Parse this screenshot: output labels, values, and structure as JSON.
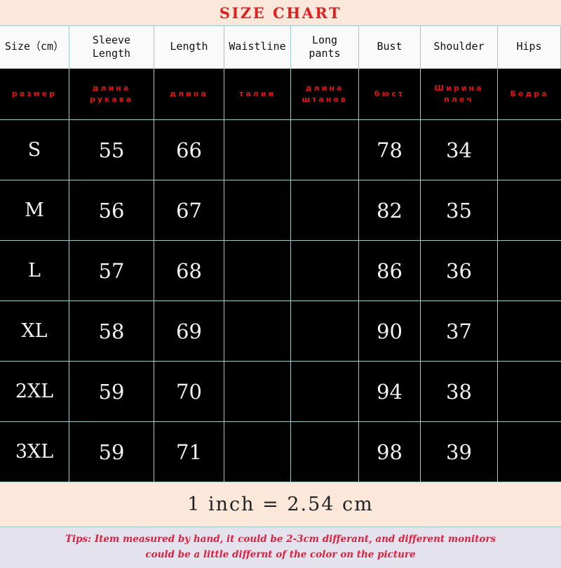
{
  "title": "SIZE CHART",
  "table": {
    "columns": [
      {
        "header": "Size（cm）",
        "ru": "размер"
      },
      {
        "header": "Sleeve Length",
        "ru": "длина рукава"
      },
      {
        "header": "Length",
        "ru": "длина"
      },
      {
        "header": "Waistline",
        "ru": "талии"
      },
      {
        "header": "Long pants",
        "ru": "длина штанов"
      },
      {
        "header": "Bust",
        "ru": "бюст"
      },
      {
        "header": "Shoulder",
        "ru": "Ширина плеч"
      },
      {
        "header": "Hips",
        "ru": "Бедра"
      }
    ],
    "rows": [
      {
        "size": "S",
        "sleeve_length": "55",
        "length": "66",
        "waistline": "",
        "long_pants": "",
        "bust": "78",
        "shoulder": "34",
        "hips": ""
      },
      {
        "size": "M",
        "sleeve_length": "56",
        "length": "67",
        "waistline": "",
        "long_pants": "",
        "bust": "82",
        "shoulder": "35",
        "hips": ""
      },
      {
        "size": "L",
        "sleeve_length": "57",
        "length": "68",
        "waistline": "",
        "long_pants": "",
        "bust": "86",
        "shoulder": "36",
        "hips": ""
      },
      {
        "size": "XL",
        "sleeve_length": "58",
        "length": "69",
        "waistline": "",
        "long_pants": "",
        "bust": "90",
        "shoulder": "37",
        "hips": ""
      },
      {
        "size": "2XL",
        "sleeve_length": "59",
        "length": "70",
        "waistline": "",
        "long_pants": "",
        "bust": "94",
        "shoulder": "38",
        "hips": ""
      },
      {
        "size": "3XL",
        "sleeve_length": "59",
        "length": "71",
        "waistline": "",
        "long_pants": "",
        "bust": "98",
        "shoulder": "39",
        "hips": ""
      }
    ]
  },
  "conversion_note": "1 inch = 2.54 cm",
  "footer": {
    "tips_label": "Tips:",
    "line1": "Item measured by hand, it could be 2-3cm differant, and different monitors",
    "line2": "could be a little differnt of the color on the picture"
  },
  "colors": {
    "title_band": "#FCE8DA",
    "title_text": "#E02020",
    "header_band": "#FAFAFA",
    "header_text": "#111111",
    "grid_line": "#9FC8C8",
    "body_background": "#000000",
    "body_text": "#F2F2F2",
    "russian_text": "#E81010",
    "footer_band": "#E4E2EC",
    "footer_text": "#E02040"
  }
}
